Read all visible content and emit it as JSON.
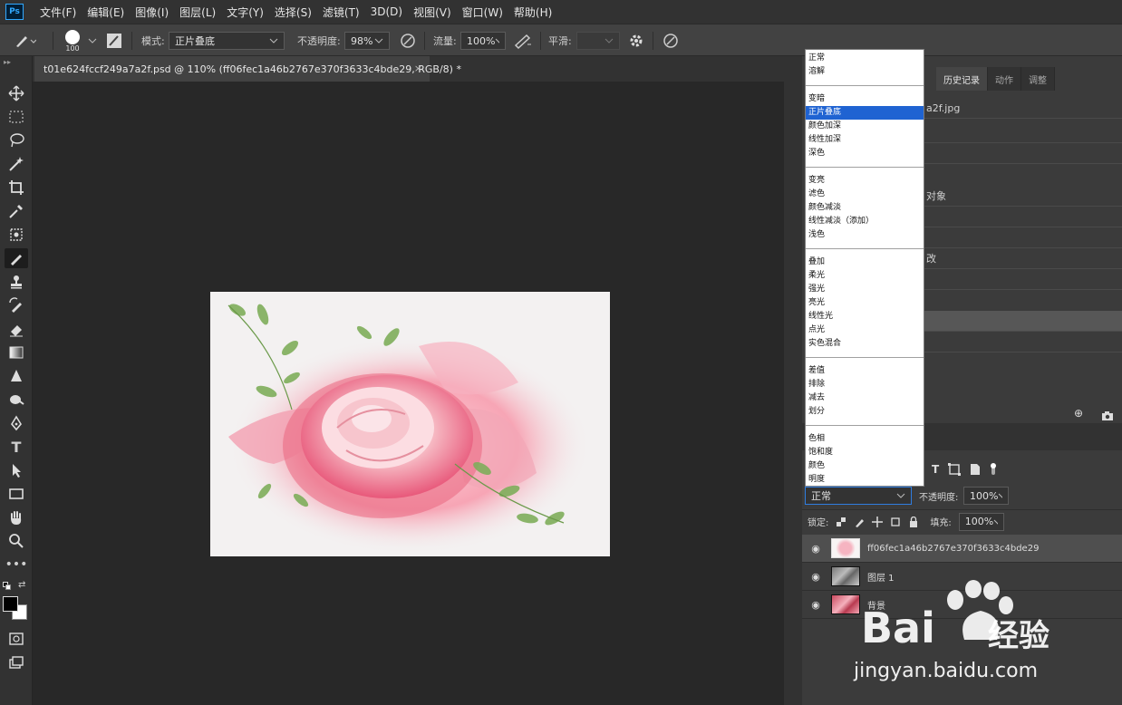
{
  "menu": {
    "app_icon": "Ps",
    "items": [
      "文件(F)",
      "编辑(E)",
      "图像(I)",
      "图层(L)",
      "文字(Y)",
      "选择(S)",
      "滤镜(T)",
      "3D(D)",
      "视图(V)",
      "窗口(W)",
      "帮助(H)"
    ]
  },
  "options": {
    "brush_size": "100",
    "mode_label": "模式:",
    "mode_value": "正片叠底",
    "opacity_label": "不透明度:",
    "opacity_value": "98%",
    "flow_label": "流量:",
    "flow_value": "100%",
    "smooth_label": "平滑:",
    "smooth_value": ""
  },
  "document": {
    "tab_title": "t01e624fccf249a7a2f.psd @ 110% (ff06fec1a46b2767e370f3633c4bde29, RGB/8) *",
    "close_glyph": "×"
  },
  "tools": [
    "move-tool",
    "marquee-tool",
    "lasso-tool",
    "magic-wand-tool",
    "crop-tool",
    "eyedropper-tool",
    "healing-tool",
    "brush-tool",
    "stamp-tool",
    "history-brush-tool",
    "eraser-tool",
    "gradient-tool",
    "blur-tool",
    "dodge-tool",
    "pen-tool",
    "type-tool",
    "path-select-tool",
    "shape-tool",
    "hand-tool",
    "zoom-tool",
    "more-tool"
  ],
  "panels": {
    "tabs": [
      "历史记录",
      "动作",
      "调整"
    ],
    "history_rows": [
      "a2f.jpg",
      "",
      "",
      "对象",
      "",
      "",
      "改",
      "",
      "",
      ""
    ],
    "history_highlight_index": 8
  },
  "blend_modes": {
    "groups": [
      [
        "正常",
        "溶解"
      ],
      [
        "变暗",
        "正片叠底",
        "颜色加深",
        "线性加深",
        "深色"
      ],
      [
        "变亮",
        "滤色",
        "颜色减淡",
        "线性减淡（添加）",
        "浅色"
      ],
      [
        "叠加",
        "柔光",
        "强光",
        "亮光",
        "线性光",
        "点光",
        "实色混合"
      ],
      [
        "差值",
        "排除",
        "减去",
        "划分"
      ],
      [
        "色相",
        "饱和度",
        "颜色",
        "明度"
      ]
    ],
    "selected": "正片叠底"
  },
  "layers": {
    "blend_value": "正常",
    "opacity_label": "不透明度:",
    "opacity_value": "100%",
    "lock_label": "锁定:",
    "fill_label": "填充:",
    "fill_value": "100%",
    "items": [
      {
        "name": "ff06fec1a46b2767e370f3633c4bde29",
        "selected": true
      },
      {
        "name": "图层 1",
        "selected": false
      },
      {
        "name": "背景",
        "selected": false
      }
    ]
  },
  "watermark": {
    "brand": "Bai",
    "brand_suffix": "经验",
    "url": "jingyan.baidu.com"
  },
  "colors": {
    "accent_selected": "#1f63d2",
    "ps_blue": "#31a8ff"
  }
}
